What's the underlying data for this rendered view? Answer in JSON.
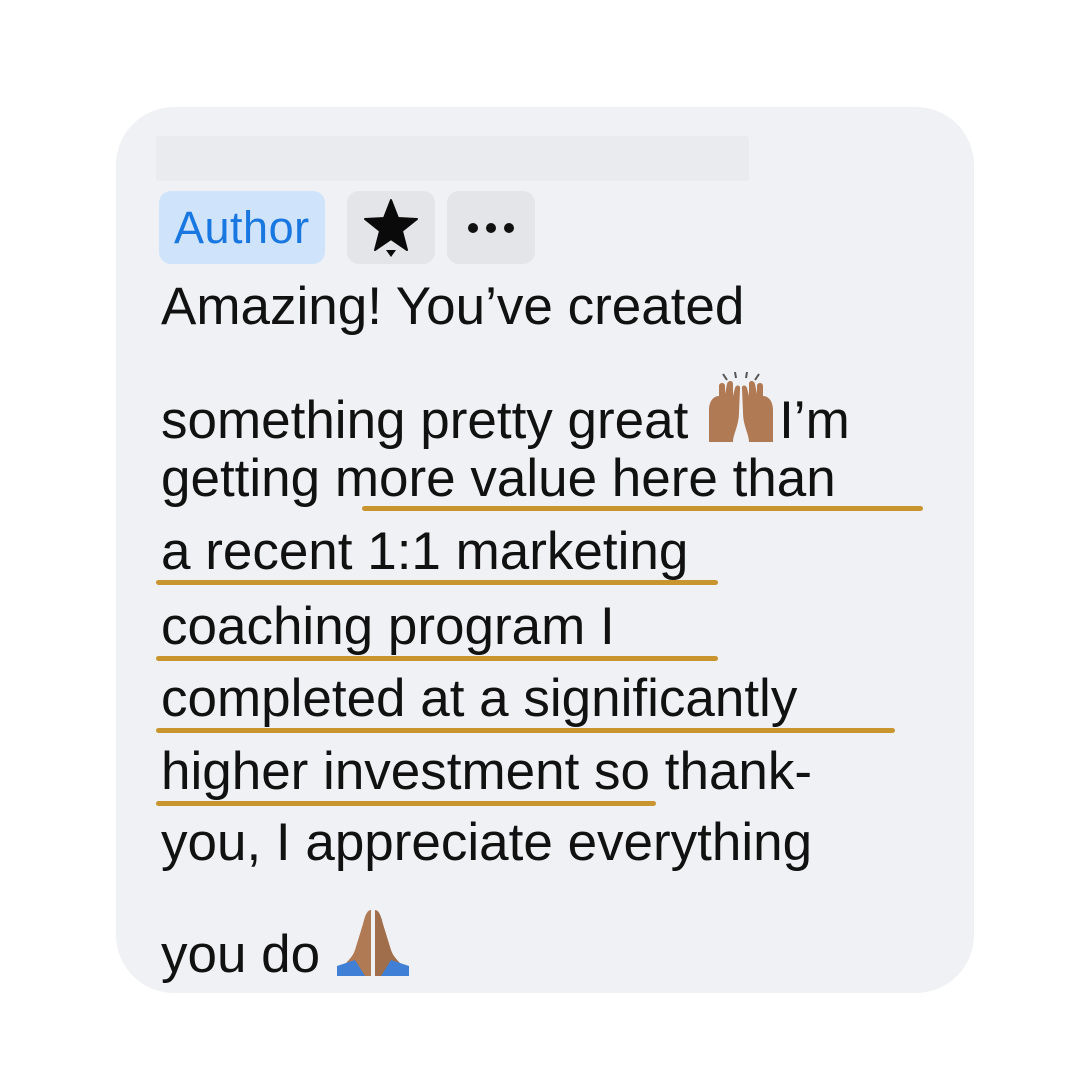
{
  "comment": {
    "author_badge": "Author",
    "lines": [
      "Amazing! You’ve created",
      "something pretty great",
      "I’m",
      "getting",
      "more value here than",
      "a recent 1:1 marketing",
      "coaching program I",
      "completed at a significantly",
      "higher investment so thank-",
      "you, I appreciate everything",
      "you do"
    ]
  },
  "icons": {
    "star": "star-icon",
    "more": "more-horizontal-icon",
    "raised_hands": "raising-hands-emoji",
    "folded_hands": "folded-hands-emoji"
  },
  "colors": {
    "card_background": "#f0f1f4",
    "author_badge_bg": "#cfe4fb",
    "author_badge_text": "#1877e0",
    "underline": "#c9952e"
  }
}
